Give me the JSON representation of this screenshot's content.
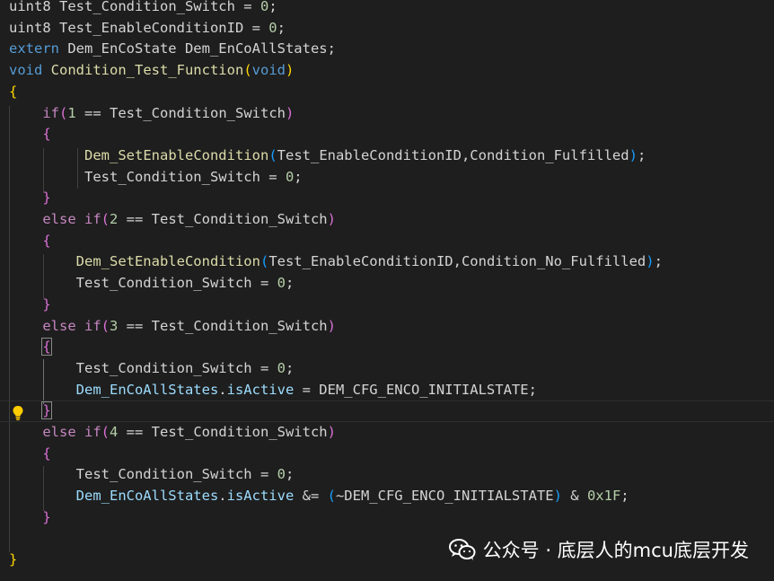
{
  "lines": [
    {
      "tokens": [
        [
          "ty",
          "uint8 "
        ],
        [
          "id",
          "Test_Condition_Switch = "
        ],
        [
          "num",
          "0"
        ],
        [
          "id",
          ";"
        ]
      ]
    },
    {
      "tokens": [
        [
          "ty",
          "uint8 "
        ],
        [
          "id",
          "Test_EnableConditionID = "
        ],
        [
          "num",
          "0"
        ],
        [
          "id",
          ";"
        ]
      ]
    },
    {
      "tokens": [
        [
          "kwb",
          "extern "
        ],
        [
          "id",
          "Dem_EnCoState Dem_EnCoAllStates;"
        ]
      ]
    },
    {
      "tokens": [
        [
          "kwb",
          "void "
        ],
        [
          "fn",
          "Condition_Test_Function"
        ],
        [
          "p1",
          "("
        ],
        [
          "kwb",
          "void"
        ],
        [
          "p1",
          ")"
        ]
      ]
    },
    {
      "tokens": [
        [
          "p1",
          "{"
        ]
      ]
    },
    {
      "tokens": [
        [
          "id",
          "    "
        ],
        [
          "kw",
          "if"
        ],
        [
          "p2",
          "("
        ],
        [
          "num",
          "1"
        ],
        [
          "id",
          " == Test_Condition_Switch"
        ],
        [
          "p2",
          ")"
        ]
      ]
    },
    {
      "tokens": [
        [
          "id",
          "    "
        ],
        [
          "p2",
          "{"
        ]
      ]
    },
    {
      "tokens": [
        [
          "id",
          "         "
        ],
        [
          "fn",
          "Dem_SetEnableCondition"
        ],
        [
          "p3",
          "("
        ],
        [
          "id",
          "Test_EnableConditionID,Condition_Fulfilled"
        ],
        [
          "p3",
          ")"
        ],
        [
          "id",
          ";"
        ]
      ]
    },
    {
      "tokens": [
        [
          "id",
          "         Test_Condition_Switch = "
        ],
        [
          "num",
          "0"
        ],
        [
          "id",
          ";"
        ]
      ]
    },
    {
      "tokens": [
        [
          "id",
          "    "
        ],
        [
          "p2",
          "}"
        ]
      ]
    },
    {
      "tokens": [
        [
          "id",
          "    "
        ],
        [
          "kw",
          "else if"
        ],
        [
          "p2",
          "("
        ],
        [
          "num",
          "2"
        ],
        [
          "id",
          " == Test_Condition_Switch"
        ],
        [
          "p2",
          ")"
        ]
      ]
    },
    {
      "tokens": [
        [
          "id",
          "    "
        ],
        [
          "p2",
          "{"
        ]
      ]
    },
    {
      "tokens": [
        [
          "id",
          "        "
        ],
        [
          "fn",
          "Dem_SetEnableCondition"
        ],
        [
          "p3",
          "("
        ],
        [
          "id",
          "Test_EnableConditionID,Condition_No_Fulfilled"
        ],
        [
          "p3",
          ")"
        ],
        [
          "id",
          ";"
        ]
      ]
    },
    {
      "tokens": [
        [
          "id",
          "        Test_Condition_Switch = "
        ],
        [
          "num",
          "0"
        ],
        [
          "id",
          ";"
        ]
      ]
    },
    {
      "tokens": [
        [
          "id",
          "    "
        ],
        [
          "p2",
          "}"
        ]
      ]
    },
    {
      "tokens": [
        [
          "id",
          "    "
        ],
        [
          "kw",
          "else if"
        ],
        [
          "p2",
          "("
        ],
        [
          "num",
          "3"
        ],
        [
          "id",
          " == Test_Condition_Switch"
        ],
        [
          "p2",
          ")"
        ]
      ]
    },
    {
      "tokens": [
        [
          "id",
          "    "
        ],
        [
          "p2",
          "{"
        ]
      ]
    },
    {
      "tokens": [
        [
          "id",
          "        Test_Condition_Switch = "
        ],
        [
          "num",
          "0"
        ],
        [
          "id",
          ";"
        ]
      ]
    },
    {
      "tokens": [
        [
          "id",
          "        "
        ],
        [
          "var",
          "Dem_EnCoAllStates"
        ],
        [
          "id",
          "."
        ],
        [
          "var",
          "isActive"
        ],
        [
          "id",
          " = DEM_CFG_ENCO_INITIALSTATE;"
        ]
      ]
    },
    {
      "tokens": [
        [
          "id",
          "    "
        ],
        [
          "p2",
          "}"
        ]
      ]
    },
    {
      "tokens": [
        [
          "id",
          "    "
        ],
        [
          "kw",
          "else if"
        ],
        [
          "p2",
          "("
        ],
        [
          "num",
          "4"
        ],
        [
          "id",
          " == Test_Condition_Switch"
        ],
        [
          "p2",
          ")"
        ]
      ]
    },
    {
      "tokens": [
        [
          "id",
          "    "
        ],
        [
          "p2",
          "{"
        ]
      ]
    },
    {
      "tokens": [
        [
          "id",
          "        Test_Condition_Switch = "
        ],
        [
          "num",
          "0"
        ],
        [
          "id",
          ";"
        ]
      ]
    },
    {
      "tokens": [
        [
          "id",
          "        "
        ],
        [
          "var",
          "Dem_EnCoAllStates"
        ],
        [
          "id",
          "."
        ],
        [
          "var",
          "isActive"
        ],
        [
          "id",
          " &= "
        ],
        [
          "p3",
          "("
        ],
        [
          "id",
          "~DEM_CFG_ENCO_INITIALSTATE"
        ],
        [
          "p3",
          ")"
        ],
        [
          "id",
          " & "
        ],
        [
          "num",
          "0x1F"
        ],
        [
          "id",
          ";"
        ]
      ]
    },
    {
      "tokens": [
        [
          "id",
          "    "
        ],
        [
          "p2",
          "}"
        ]
      ]
    },
    {
      "tokens": [
        [
          "id",
          ""
        ]
      ]
    },
    {
      "tokens": [
        [
          "p1",
          "}"
        ]
      ]
    }
  ],
  "watermark": {
    "text": "公众号 · 底层人的mcu底层开发",
    "icon": "wechat-icon"
  },
  "colors": {
    "background": "#1e1e1e",
    "keyword": "#c586c0",
    "function": "#dcdcaa",
    "number": "#b5cea8",
    "variable": "#9cdcfe"
  }
}
